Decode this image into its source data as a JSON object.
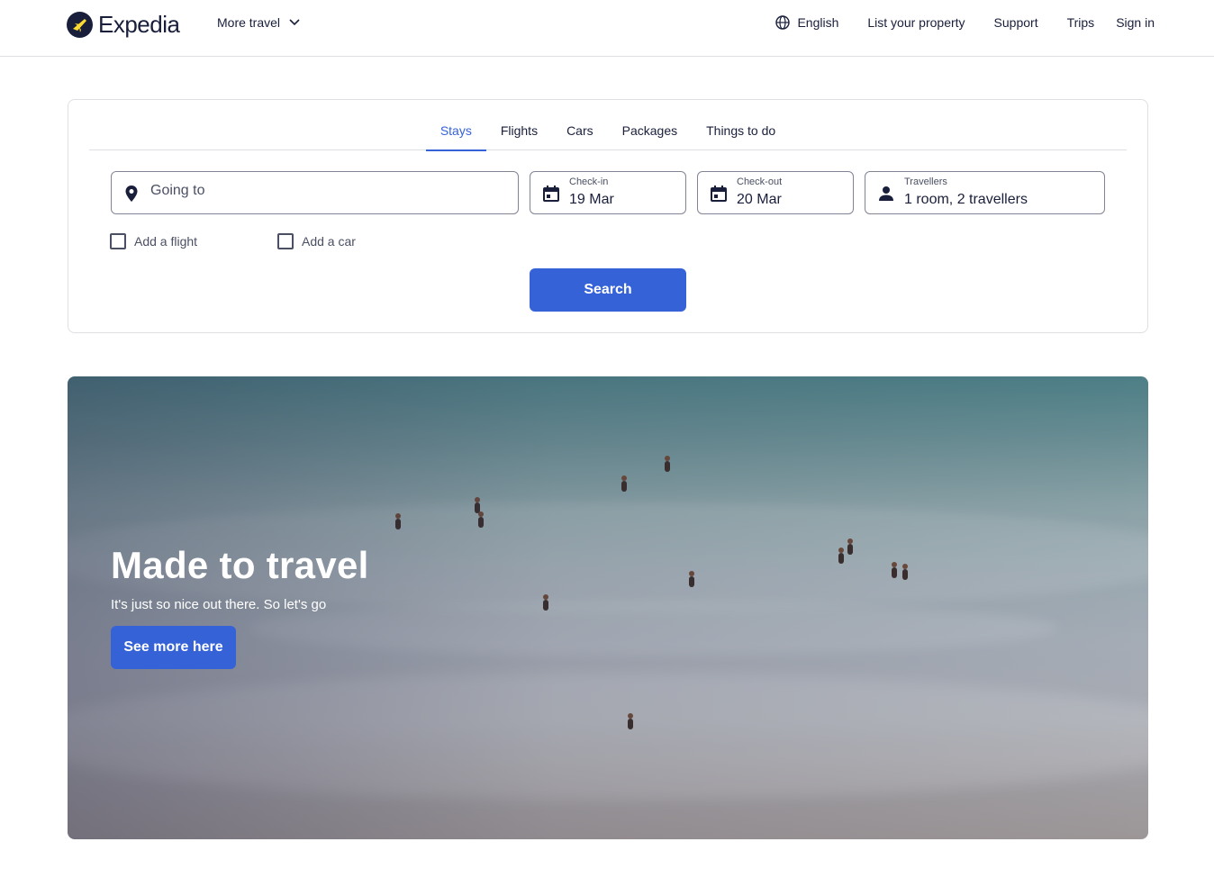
{
  "header": {
    "brand": "Expedia",
    "more_travel": "More travel",
    "language": "English",
    "links": [
      "List your property",
      "Support",
      "Trips",
      "Sign in"
    ]
  },
  "search": {
    "tabs": [
      {
        "label": "Stays",
        "active": true
      },
      {
        "label": "Flights",
        "active": false
      },
      {
        "label": "Cars",
        "active": false
      },
      {
        "label": "Packages",
        "active": false
      },
      {
        "label": "Things to do",
        "active": false
      }
    ],
    "destination_placeholder": "Going to",
    "checkin_label": "Check-in",
    "checkin_value": "19 Mar",
    "checkout_label": "Check-out",
    "checkout_value": "20 Mar",
    "travellers_label": "Travellers",
    "travellers_value": "1 room, 2 travellers",
    "add_flight": "Add a flight",
    "add_car": "Add a car",
    "search_button": "Search"
  },
  "hero": {
    "title": "Made to travel",
    "subtitle": "It's just so nice out there. So let's go",
    "button": "See more here"
  },
  "colors": {
    "accent": "#3662d8",
    "text": "#191e3b",
    "border": "#dfe0e4"
  }
}
